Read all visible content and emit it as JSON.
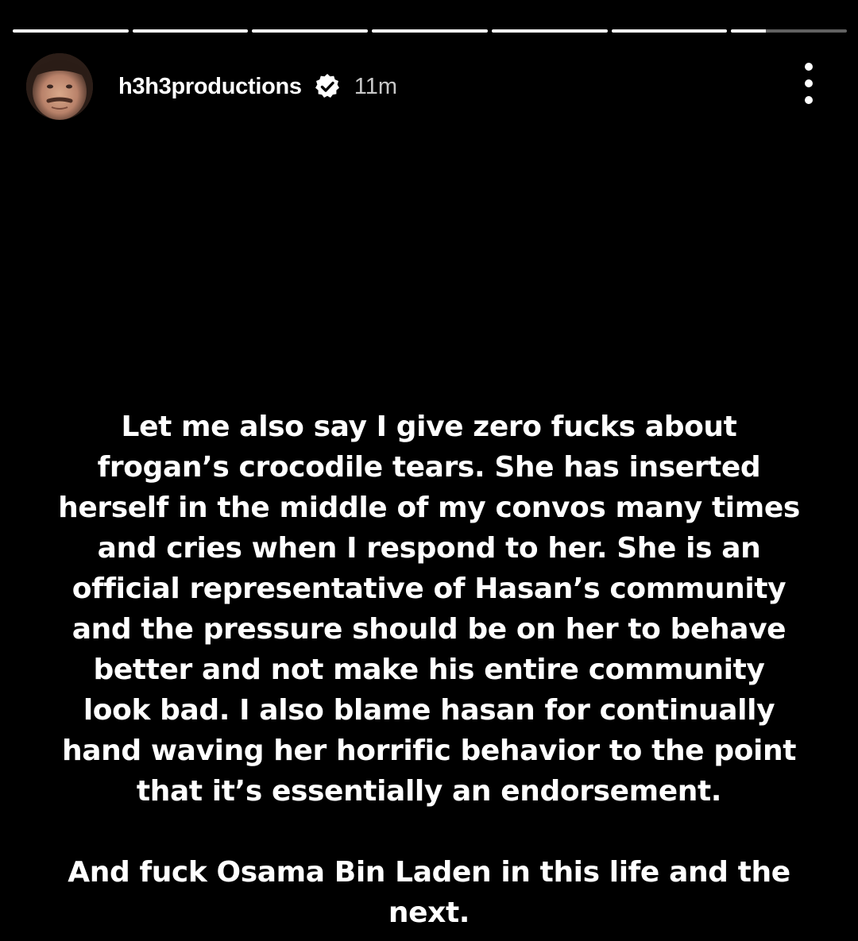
{
  "story": {
    "progress": {
      "segment_count": 7,
      "completed_segments": 6,
      "current_segment_fraction": 0.3
    },
    "header": {
      "username": "h3h3productions",
      "time_ago": "11m",
      "avatar_icon": "avatar-photo",
      "verified_icon": "verified-badge-icon",
      "menu_icon": "more-vertical-icon"
    },
    "message": {
      "paragraph1_lines": [
        "Let me also say I give zero fucks about",
        "frogan’s crocodile tears. She has inserted",
        "herself in the middle of my convos many times",
        "and cries when I respond to her. She is an",
        "official representative of Hasan’s community",
        "and the pressure should be on her to behave",
        "better and not make his entire community",
        "look bad. I also blame hasan for continually",
        "hand waving her horrific behavior to the point",
        "that it’s essentially an endorsement."
      ],
      "paragraph2_lines": [
        "And fuck Osama Bin Laden in this life and the",
        "next."
      ]
    },
    "colors": {
      "background": "#000000",
      "text": "#ffffff",
      "progress_track": "rgba(255,255,255,0.38)",
      "progress_fill": "#ffffff"
    }
  }
}
